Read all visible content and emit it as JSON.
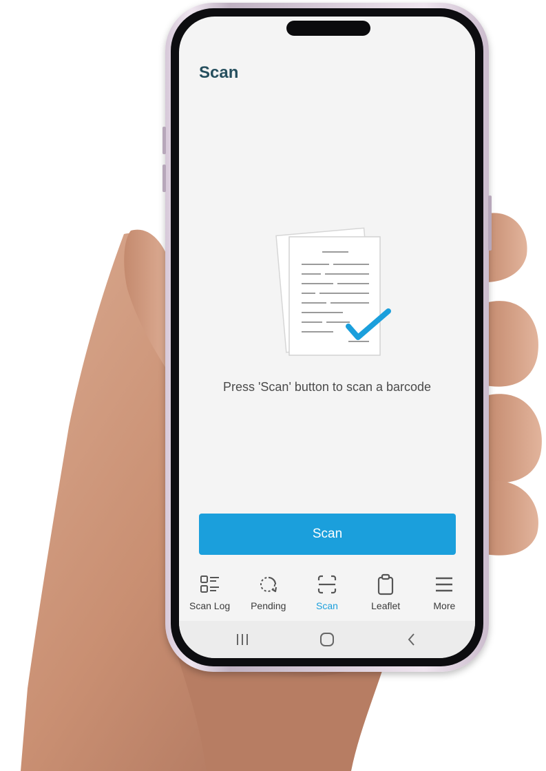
{
  "screen": {
    "title": "Scan",
    "empty_state": {
      "message": "Press 'Scan' button to scan a barcode",
      "illustration": "document-checkmark-icon"
    },
    "scan_button_label": "Scan",
    "accent_color": "#1b9fdc",
    "title_color": "#264f5e"
  },
  "bottom_nav": {
    "items": [
      {
        "label": "Scan Log",
        "icon": "list-icon",
        "active": false
      },
      {
        "label": "Pending",
        "icon": "refresh-icon",
        "active": false
      },
      {
        "label": "Scan",
        "icon": "scan-frame-icon",
        "active": true
      },
      {
        "label": "Leaflet",
        "icon": "clipboard-icon",
        "active": false
      },
      {
        "label": "More",
        "icon": "menu-icon",
        "active": false
      }
    ]
  },
  "system_nav": {
    "buttons": [
      "recent-apps-icon",
      "home-icon",
      "back-icon"
    ]
  }
}
